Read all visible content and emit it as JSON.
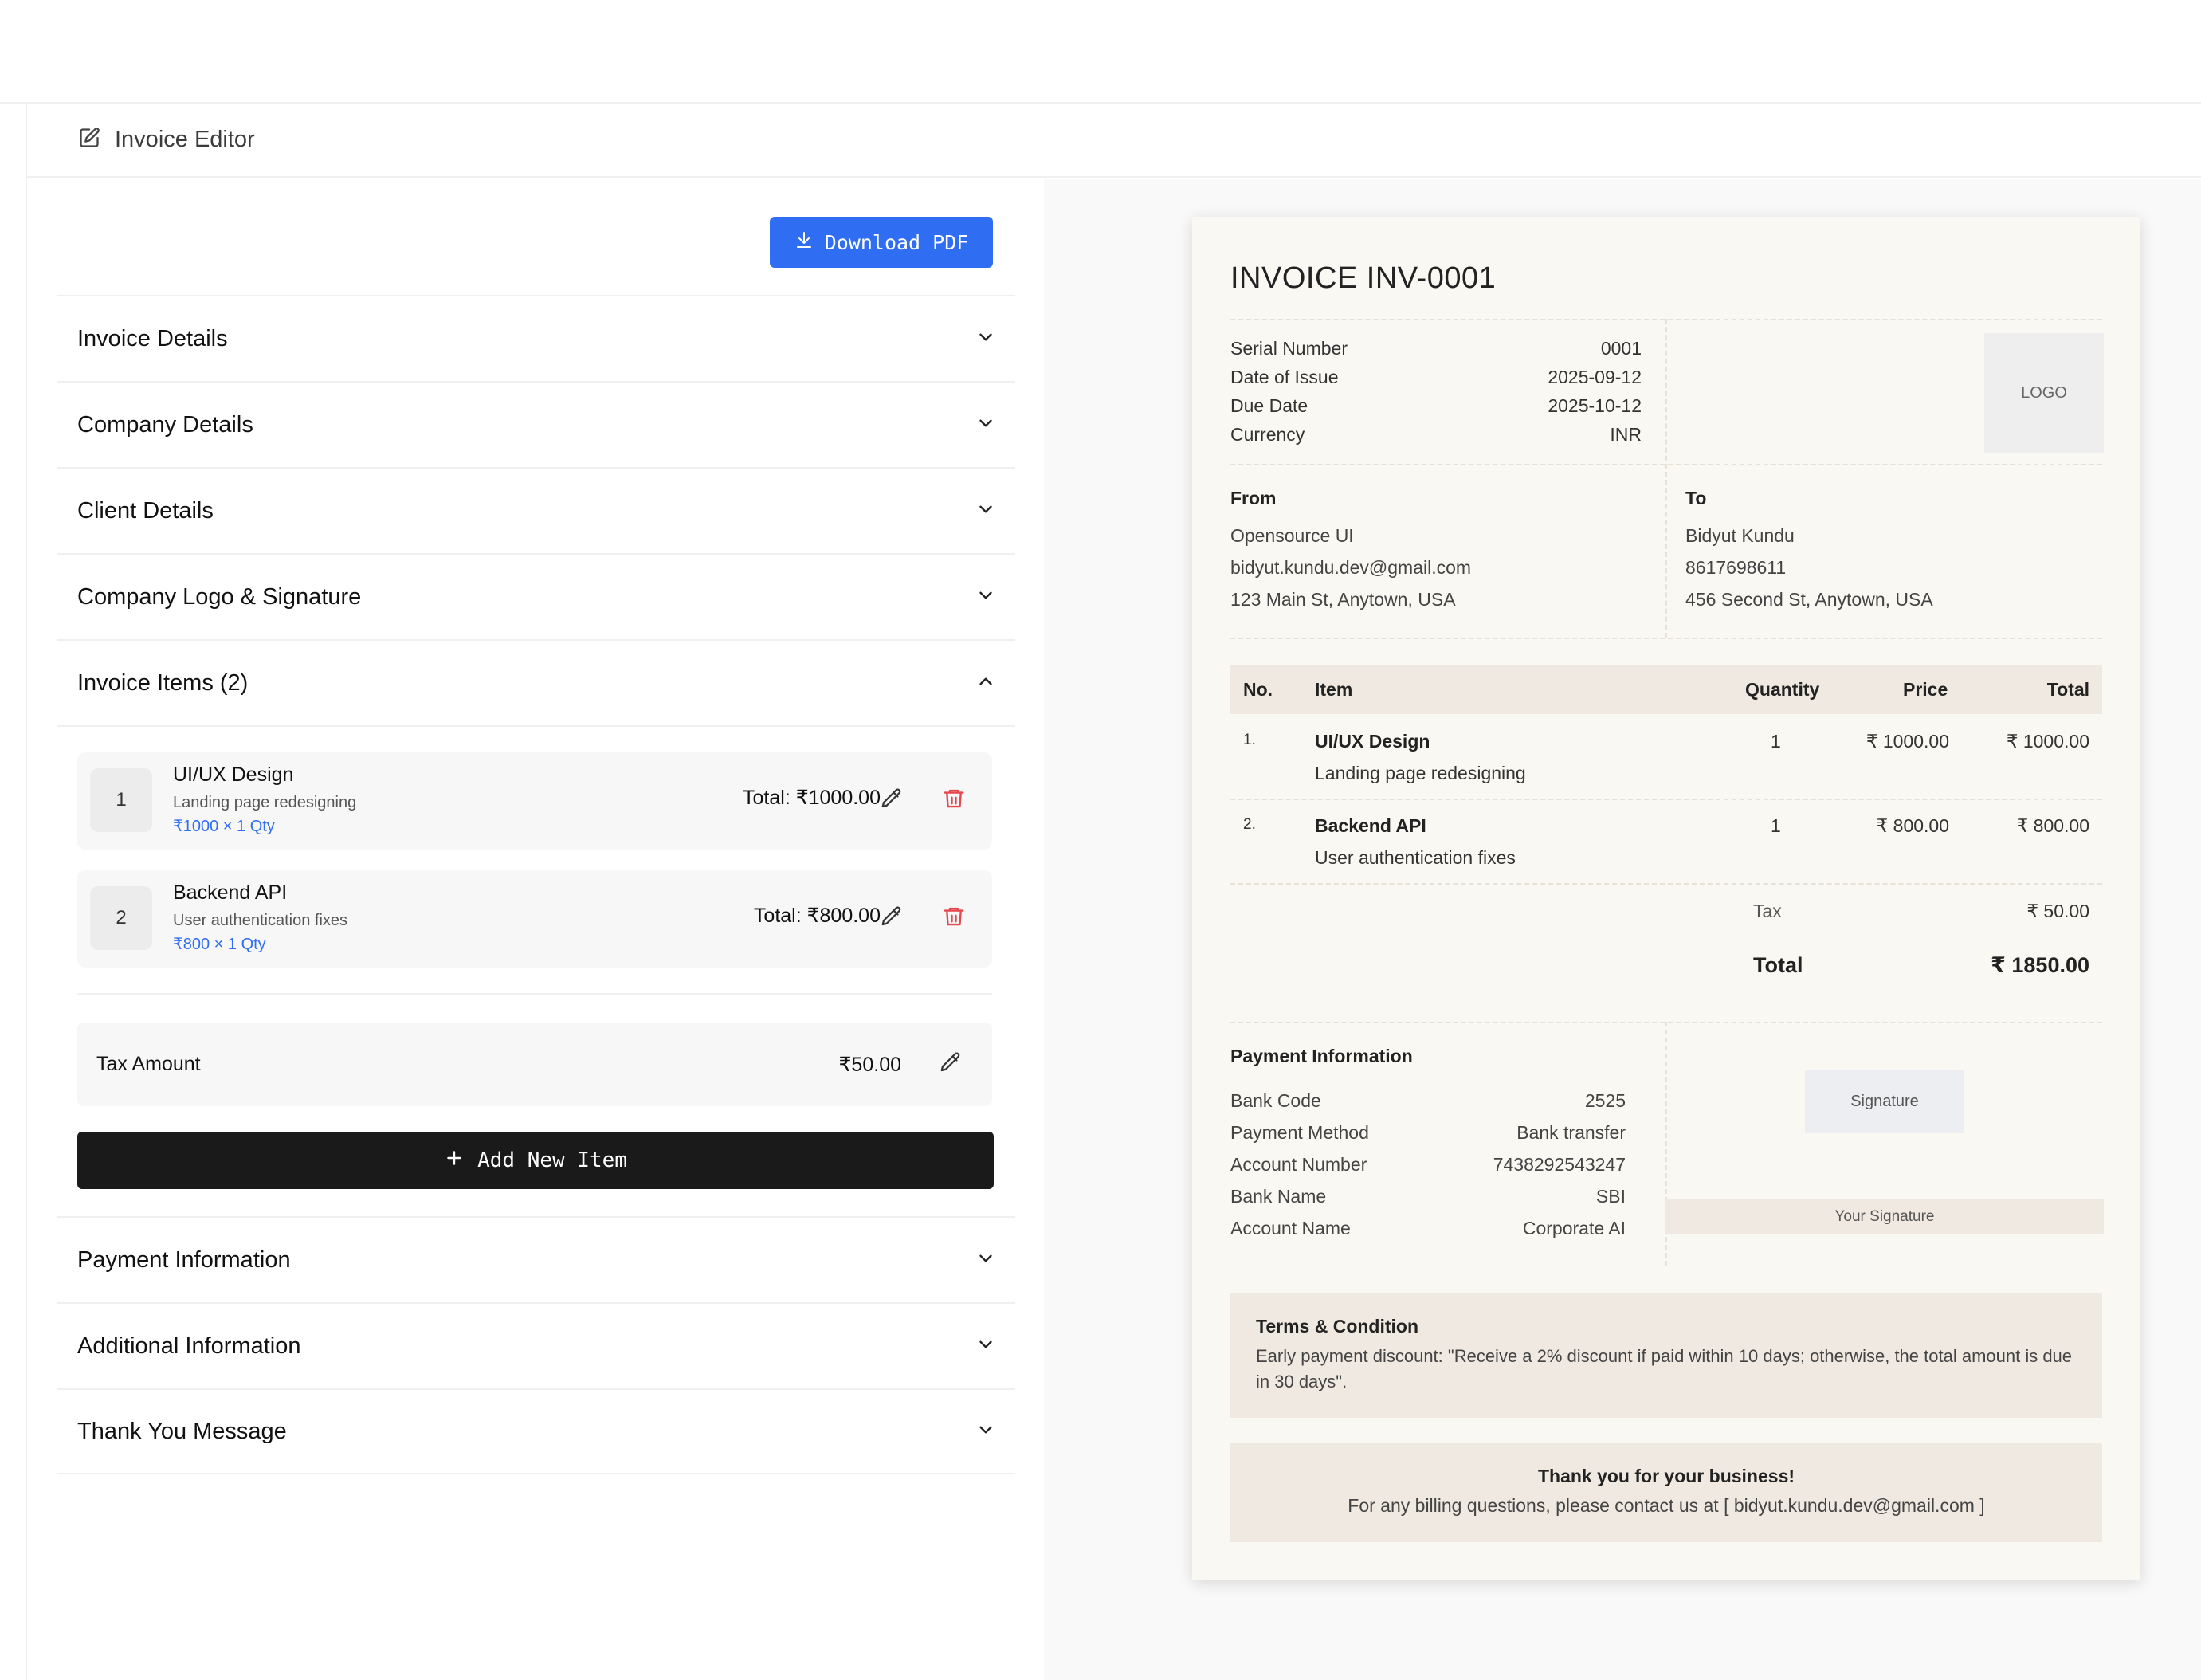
{
  "header": {
    "title": "Invoice Editor"
  },
  "toolbar": {
    "download_label": "Download PDF"
  },
  "sections": {
    "invoice_details": "Invoice Details",
    "company_details": "Company Details",
    "client_details": "Client Details",
    "logo_signature": "Company Logo & Signature",
    "invoice_items": "Invoice Items (2)",
    "payment_information": "Payment Information",
    "additional_information": "Additional Information",
    "thank_you_message": "Thank You Message"
  },
  "items": [
    {
      "num": "1",
      "name": "UI/UX Design",
      "desc": "Landing page redesigning",
      "calc": "₹1000 × 1 Qty",
      "total": "Total: ₹1000.00"
    },
    {
      "num": "2",
      "name": "Backend API",
      "desc": "User authentication fixes",
      "calc": "₹800 × 1 Qty",
      "total": "Total: ₹800.00"
    }
  ],
  "tax": {
    "label": "Tax Amount",
    "value": "₹50.00"
  },
  "add_item_label": "Add New Item",
  "invoice": {
    "title": "INVOICE INV-0001",
    "meta": [
      {
        "key": "Serial Number",
        "value": "0001"
      },
      {
        "key": "Date of Issue",
        "value": "2025-09-12"
      },
      {
        "key": "Due Date",
        "value": "2025-10-12"
      },
      {
        "key": "Currency",
        "value": "INR"
      }
    ],
    "logo_placeholder": "LOGO",
    "from": {
      "heading": "From",
      "name": "Opensource UI",
      "email": "bidyut.kundu.dev@gmail.com",
      "address": "123 Main St, Anytown, USA"
    },
    "to": {
      "heading": "To",
      "name": "Bidyut Kundu",
      "phone": "8617698611",
      "address": "456 Second St, Anytown, USA"
    },
    "table": {
      "headers": {
        "no": "No.",
        "item": "Item",
        "qty": "Quantity",
        "price": "Price",
        "total": "Total"
      },
      "rows": [
        {
          "no": "1.",
          "name": "UI/UX Design",
          "desc": "Landing page redesigning",
          "qty": "1",
          "price": "₹ 1000.00",
          "total": "₹ 1000.00"
        },
        {
          "no": "2.",
          "name": "Backend API",
          "desc": "User authentication fixes",
          "qty": "1",
          "price": "₹ 800.00",
          "total": "₹ 800.00"
        }
      ],
      "tax_label": "Tax",
      "tax_value": "₹ 50.00",
      "total_label": "Total",
      "total_value": "₹ 1850.00"
    },
    "payment": {
      "heading": "Payment Information",
      "rows": [
        {
          "key": "Bank Code",
          "value": "2525"
        },
        {
          "key": "Payment Method",
          "value": "Bank transfer"
        },
        {
          "key": "Account Number",
          "value": "7438292543247"
        },
        {
          "key": "Bank Name",
          "value": "SBI"
        },
        {
          "key": "Account Name",
          "value": "Corporate AI"
        }
      ]
    },
    "signature_placeholder": "Signature",
    "signature_caption": "Your Signature",
    "terms": {
      "heading": "Terms & Condition",
      "text": "Early payment discount: \"Receive a 2% discount if paid within 10 days; otherwise, the total amount is due in 30 days\"."
    },
    "thanks": {
      "heading": "Thank you for your business!",
      "text": "For any billing questions, please contact us at [ bidyut.kundu.dev@gmail.com ]"
    }
  },
  "colors": {
    "accent": "#2f6df2",
    "danger": "#e5484d",
    "dark_button": "#1a1a1a",
    "paper": "#faf8f3"
  }
}
